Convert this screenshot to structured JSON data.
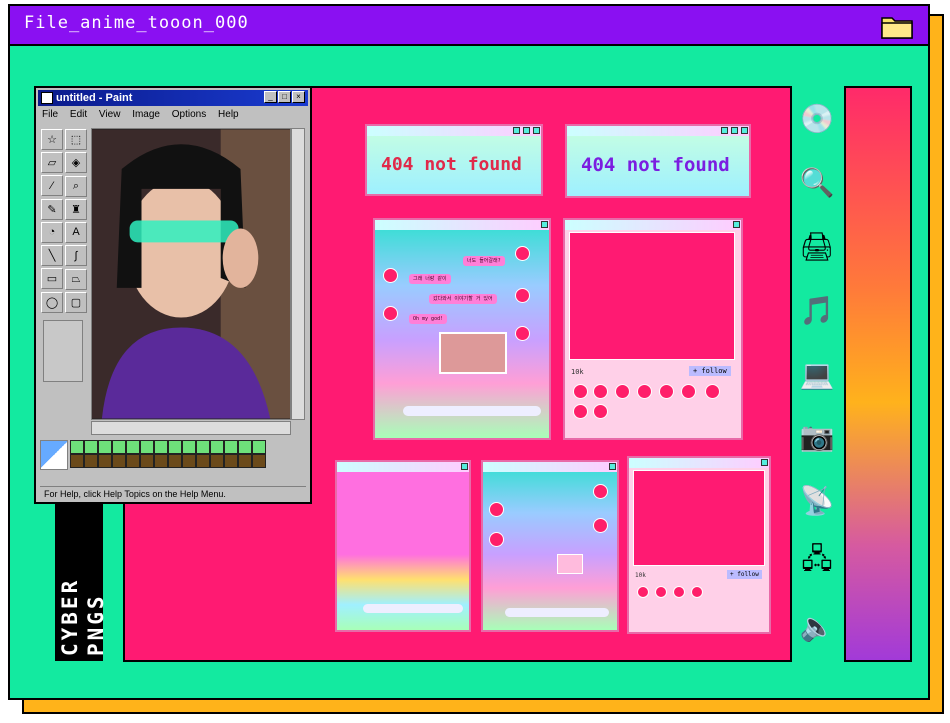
{
  "window": {
    "title": "File_anime_tooon_000",
    "folder_icon": "folder-icon"
  },
  "brand": {
    "line1": "CYBER",
    "line2": "PNGS"
  },
  "paint": {
    "title": "untitled - Paint",
    "menu": [
      "File",
      "Edit",
      "View",
      "Image",
      "Options",
      "Help"
    ],
    "status": "For Help, click Help Topics on the Help Menu."
  },
  "windows": {
    "nf1": "404 not found",
    "nf2": "404 not found",
    "chat1_msgs": [
      "너도 들어갈래?",
      "그래 너랑 같이",
      "갔다와서 이야기할 거 있어",
      "Oh my god!"
    ],
    "profile_count": "10k",
    "follow_label": "+ follow"
  },
  "side_icons": [
    "disk-icon",
    "search-doc-icon",
    "printer-icon",
    "music-cd-icon",
    "computer-icon",
    "camera-icon",
    "satellite-icon",
    "network-icon",
    "speaker-icon"
  ],
  "colors": {
    "teal": "#13eaa0",
    "purple": "#8a10f2",
    "pink": "#ff1a72",
    "orange": "#ffb31a"
  }
}
